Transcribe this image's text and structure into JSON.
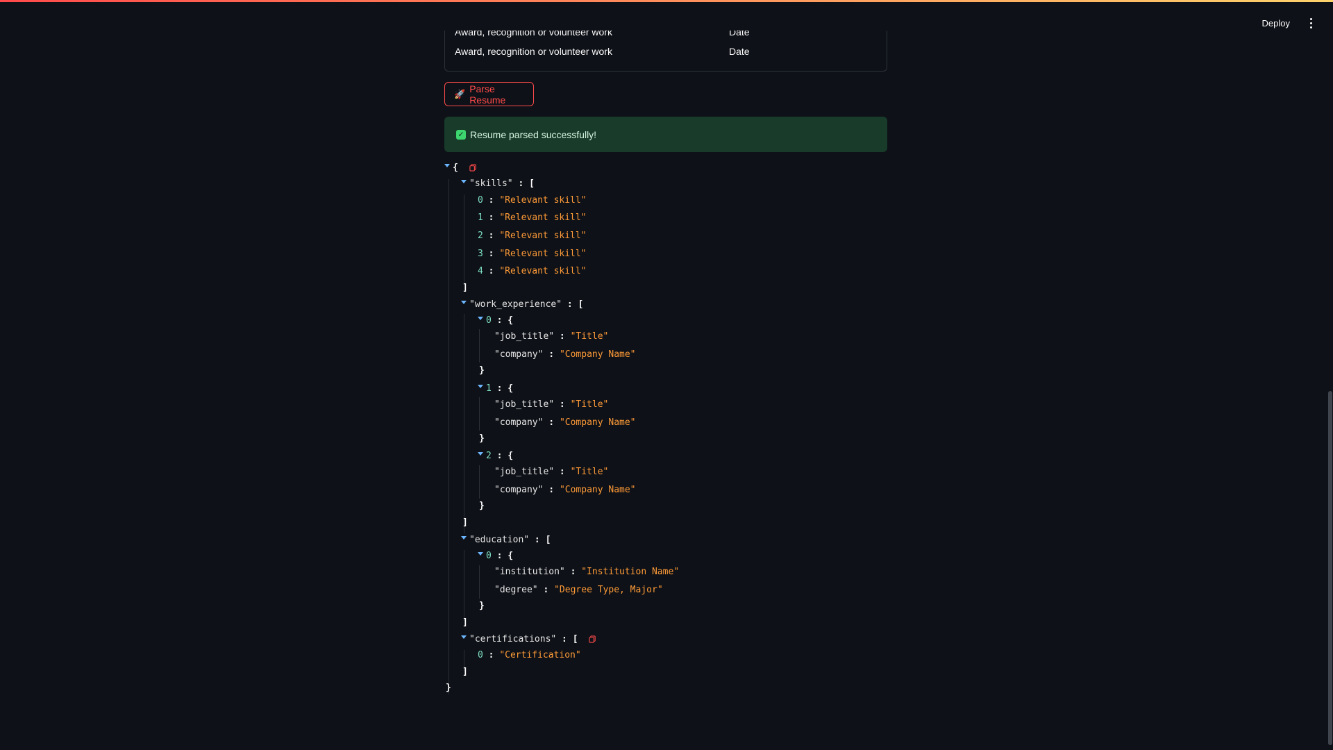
{
  "header": {
    "deploy_label": "Deploy"
  },
  "table": {
    "rows": [
      {
        "item": "Award, recognition or volunteer work",
        "date": "Date"
      },
      {
        "item": "Award, recognition or volunteer work",
        "date": "Date"
      }
    ]
  },
  "parse_button": {
    "icon": "rocket-icon",
    "label": "Parse Resume"
  },
  "alert": {
    "icon": "check-icon",
    "message": "Resume parsed successfully!",
    "color": "#183b2a"
  },
  "json_view": {
    "skills_key": "\"skills\"",
    "skills": [
      "\"Relevant skill\"",
      "\"Relevant skill\"",
      "\"Relevant skill\"",
      "\"Relevant skill\"",
      "\"Relevant skill\""
    ],
    "work_experience_key": "\"work_experience\"",
    "work_experience": [
      {
        "job_title_key": "\"job_title\"",
        "job_title": "\"Title\"",
        "company_key": "\"company\"",
        "company": "\"Company Name\""
      },
      {
        "job_title_key": "\"job_title\"",
        "job_title": "\"Title\"",
        "company_key": "\"company\"",
        "company": "\"Company Name\""
      },
      {
        "job_title_key": "\"job_title\"",
        "job_title": "\"Title\"",
        "company_key": "\"company\"",
        "company": "\"Company Name\""
      }
    ],
    "education_key": "\"education\"",
    "education": [
      {
        "institution_key": "\"institution\"",
        "institution": "\"Institution Name\"",
        "degree_key": "\"degree\"",
        "degree": "\"Degree Type, Major\""
      }
    ],
    "certifications_key": "\"certifications\"",
    "certifications": [
      "\"Certification\""
    ]
  }
}
